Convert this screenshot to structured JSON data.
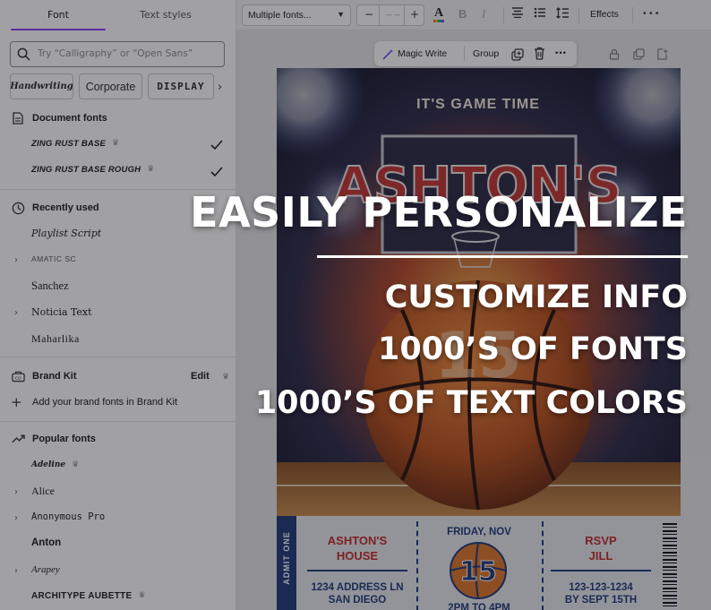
{
  "panel": {
    "tabs": [
      "Font",
      "Text styles"
    ],
    "search_placeholder": "Try “Calligraphy” or “Open Sans”",
    "chips": [
      "Handwriting",
      "Corporate",
      "DISPLAY"
    ],
    "document_fonts": {
      "title": "Document fonts",
      "items": [
        {
          "name": "ZING RUST BASE",
          "premium": true,
          "selected": true
        },
        {
          "name": "ZING RUST BASE ROUGH",
          "premium": true,
          "selected": true
        }
      ]
    },
    "recently_used": {
      "title": "Recently used",
      "items": [
        "Playlist Script",
        "AMATIC SC",
        "Sanchez",
        "Noticia Text",
        "Maharlika"
      ]
    },
    "brand_kit": {
      "title": "Brand Kit",
      "edit_label": "Edit",
      "add_label": "Add your brand fonts in Brand Kit"
    },
    "popular_fonts": {
      "title": "Popular fonts",
      "items": [
        "Adeline",
        "Alice",
        "Anonymous Pro",
        "Anton",
        "Arapey",
        "ARCHITYPE AUBETTE"
      ]
    }
  },
  "toolbar": {
    "font_select": "Multiple fonts...",
    "size_minus": "−",
    "size_value": "-- --",
    "size_plus": "+",
    "color_label": "A",
    "bold_label": "B",
    "italic_label": "I",
    "effects_label": "Effects",
    "more_label": "•••"
  },
  "floating_bar": {
    "magic_write": "Magic Write",
    "group": "Group",
    "more": "•••"
  },
  "poster": {
    "headline": "IT'S GAME TIME",
    "name_big": "ASHTON'S",
    "ticket": {
      "admit": "ADMIT ONE",
      "left_name_1": "ASHTON'S",
      "left_name_2": "HOUSE",
      "left_addr_1": "1234 ADDRESS LN",
      "left_addr_2": "SAN DIEGO",
      "date": "FRIDAY, NOV",
      "jersey_number": "15",
      "time": "2PM TO 4PM",
      "rsvp_1": "RSVP",
      "rsvp_2": "JILL",
      "phone": "123-123-1234",
      "rsvp_by": "BY SEPT 15TH"
    }
  },
  "overlay": {
    "title": "EASILY PERSONALIZE",
    "line1": "CUSTOMIZE INFO",
    "line2": "1000’S OF FONTS",
    "line3": "1000’S OF TEXT COLORS"
  },
  "colors": {
    "accent": "#8b3dff",
    "poster_blue": "#1f3a7a",
    "poster_red": "#c22b2b",
    "ball_orange": "#e0762a"
  }
}
